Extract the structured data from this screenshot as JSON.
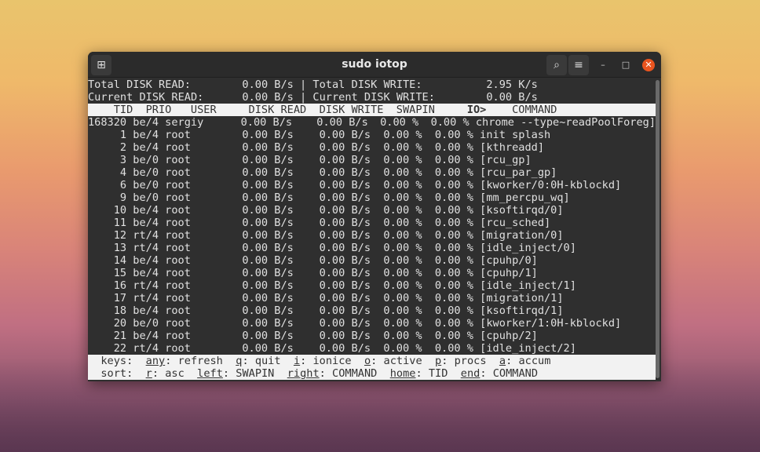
{
  "window": {
    "title": "sudo iotop"
  },
  "summary": [
    {
      "left_label": "Total DISK READ:",
      "left_value": "0.00 B/s",
      "right_label": "Total DISK WRITE:",
      "right_value": "2.95 K/s"
    },
    {
      "left_label": "Current DISK READ:",
      "left_value": "0.00 B/s",
      "right_label": "Current DISK WRITE:",
      "right_value": "0.00 B/s"
    }
  ],
  "columns": {
    "tid": "TID",
    "prio": "PRIO",
    "user": "USER",
    "disk_read": "DISK READ",
    "disk_write": "DISK WRITE",
    "swapin": "SWAPIN",
    "io": "IO>",
    "command": "COMMAND"
  },
  "rows": [
    {
      "tid": "168320",
      "prio": "be/4",
      "user": "sergiy",
      "disk_read": "0.00 B/s",
      "disk_write": "0.00 B/s",
      "swapin": "0.00 %",
      "io": "0.00 %",
      "command": "chrome --type~readPoolForeg]"
    },
    {
      "tid": "1",
      "prio": "be/4",
      "user": "root",
      "disk_read": "0.00 B/s",
      "disk_write": "0.00 B/s",
      "swapin": "0.00 %",
      "io": "0.00 %",
      "command": "init splash"
    },
    {
      "tid": "2",
      "prio": "be/4",
      "user": "root",
      "disk_read": "0.00 B/s",
      "disk_write": "0.00 B/s",
      "swapin": "0.00 %",
      "io": "0.00 %",
      "command": "[kthreadd]"
    },
    {
      "tid": "3",
      "prio": "be/0",
      "user": "root",
      "disk_read": "0.00 B/s",
      "disk_write": "0.00 B/s",
      "swapin": "0.00 %",
      "io": "0.00 %",
      "command": "[rcu_gp]"
    },
    {
      "tid": "4",
      "prio": "be/0",
      "user": "root",
      "disk_read": "0.00 B/s",
      "disk_write": "0.00 B/s",
      "swapin": "0.00 %",
      "io": "0.00 %",
      "command": "[rcu_par_gp]"
    },
    {
      "tid": "6",
      "prio": "be/0",
      "user": "root",
      "disk_read": "0.00 B/s",
      "disk_write": "0.00 B/s",
      "swapin": "0.00 %",
      "io": "0.00 %",
      "command": "[kworker/0:0H-kblockd]"
    },
    {
      "tid": "9",
      "prio": "be/0",
      "user": "root",
      "disk_read": "0.00 B/s",
      "disk_write": "0.00 B/s",
      "swapin": "0.00 %",
      "io": "0.00 %",
      "command": "[mm_percpu_wq]"
    },
    {
      "tid": "10",
      "prio": "be/4",
      "user": "root",
      "disk_read": "0.00 B/s",
      "disk_write": "0.00 B/s",
      "swapin": "0.00 %",
      "io": "0.00 %",
      "command": "[ksoftirqd/0]"
    },
    {
      "tid": "11",
      "prio": "be/4",
      "user": "root",
      "disk_read": "0.00 B/s",
      "disk_write": "0.00 B/s",
      "swapin": "0.00 %",
      "io": "0.00 %",
      "command": "[rcu_sched]"
    },
    {
      "tid": "12",
      "prio": "rt/4",
      "user": "root",
      "disk_read": "0.00 B/s",
      "disk_write": "0.00 B/s",
      "swapin": "0.00 %",
      "io": "0.00 %",
      "command": "[migration/0]"
    },
    {
      "tid": "13",
      "prio": "rt/4",
      "user": "root",
      "disk_read": "0.00 B/s",
      "disk_write": "0.00 B/s",
      "swapin": "0.00 %",
      "io": "0.00 %",
      "command": "[idle_inject/0]"
    },
    {
      "tid": "14",
      "prio": "be/4",
      "user": "root",
      "disk_read": "0.00 B/s",
      "disk_write": "0.00 B/s",
      "swapin": "0.00 %",
      "io": "0.00 %",
      "command": "[cpuhp/0]"
    },
    {
      "tid": "15",
      "prio": "be/4",
      "user": "root",
      "disk_read": "0.00 B/s",
      "disk_write": "0.00 B/s",
      "swapin": "0.00 %",
      "io": "0.00 %",
      "command": "[cpuhp/1]"
    },
    {
      "tid": "16",
      "prio": "rt/4",
      "user": "root",
      "disk_read": "0.00 B/s",
      "disk_write": "0.00 B/s",
      "swapin": "0.00 %",
      "io": "0.00 %",
      "command": "[idle_inject/1]"
    },
    {
      "tid": "17",
      "prio": "rt/4",
      "user": "root",
      "disk_read": "0.00 B/s",
      "disk_write": "0.00 B/s",
      "swapin": "0.00 %",
      "io": "0.00 %",
      "command": "[migration/1]"
    },
    {
      "tid": "18",
      "prio": "be/4",
      "user": "root",
      "disk_read": "0.00 B/s",
      "disk_write": "0.00 B/s",
      "swapin": "0.00 %",
      "io": "0.00 %",
      "command": "[ksoftirqd/1]"
    },
    {
      "tid": "20",
      "prio": "be/0",
      "user": "root",
      "disk_read": "0.00 B/s",
      "disk_write": "0.00 B/s",
      "swapin": "0.00 %",
      "io": "0.00 %",
      "command": "[kworker/1:0H-kblockd]"
    },
    {
      "tid": "21",
      "prio": "be/4",
      "user": "root",
      "disk_read": "0.00 B/s",
      "disk_write": "0.00 B/s",
      "swapin": "0.00 %",
      "io": "0.00 %",
      "command": "[cpuhp/2]"
    },
    {
      "tid": "22",
      "prio": "rt/4",
      "user": "root",
      "disk_read": "0.00 B/s",
      "disk_write": "0.00 B/s",
      "swapin": "0.00 %",
      "io": "0.00 %",
      "command": "[idle_inject/2]"
    }
  ],
  "footer": {
    "keys": {
      "label": "keys:",
      "items": [
        {
          "key": "any",
          "desc": "refresh"
        },
        {
          "key": "q",
          "desc": "quit"
        },
        {
          "key": "i",
          "desc": "ionice"
        },
        {
          "key": "o",
          "desc": "active"
        },
        {
          "key": "p",
          "desc": "procs"
        },
        {
          "key": "a",
          "desc": "accum"
        }
      ]
    },
    "sort": {
      "label": "sort:",
      "items": [
        {
          "key": "r",
          "desc": "asc"
        },
        {
          "key": "left",
          "desc": "SWAPIN"
        },
        {
          "key": "right",
          "desc": "COMMAND"
        },
        {
          "key": "home",
          "desc": "TID"
        },
        {
          "key": "end",
          "desc": "COMMAND"
        }
      ]
    }
  }
}
